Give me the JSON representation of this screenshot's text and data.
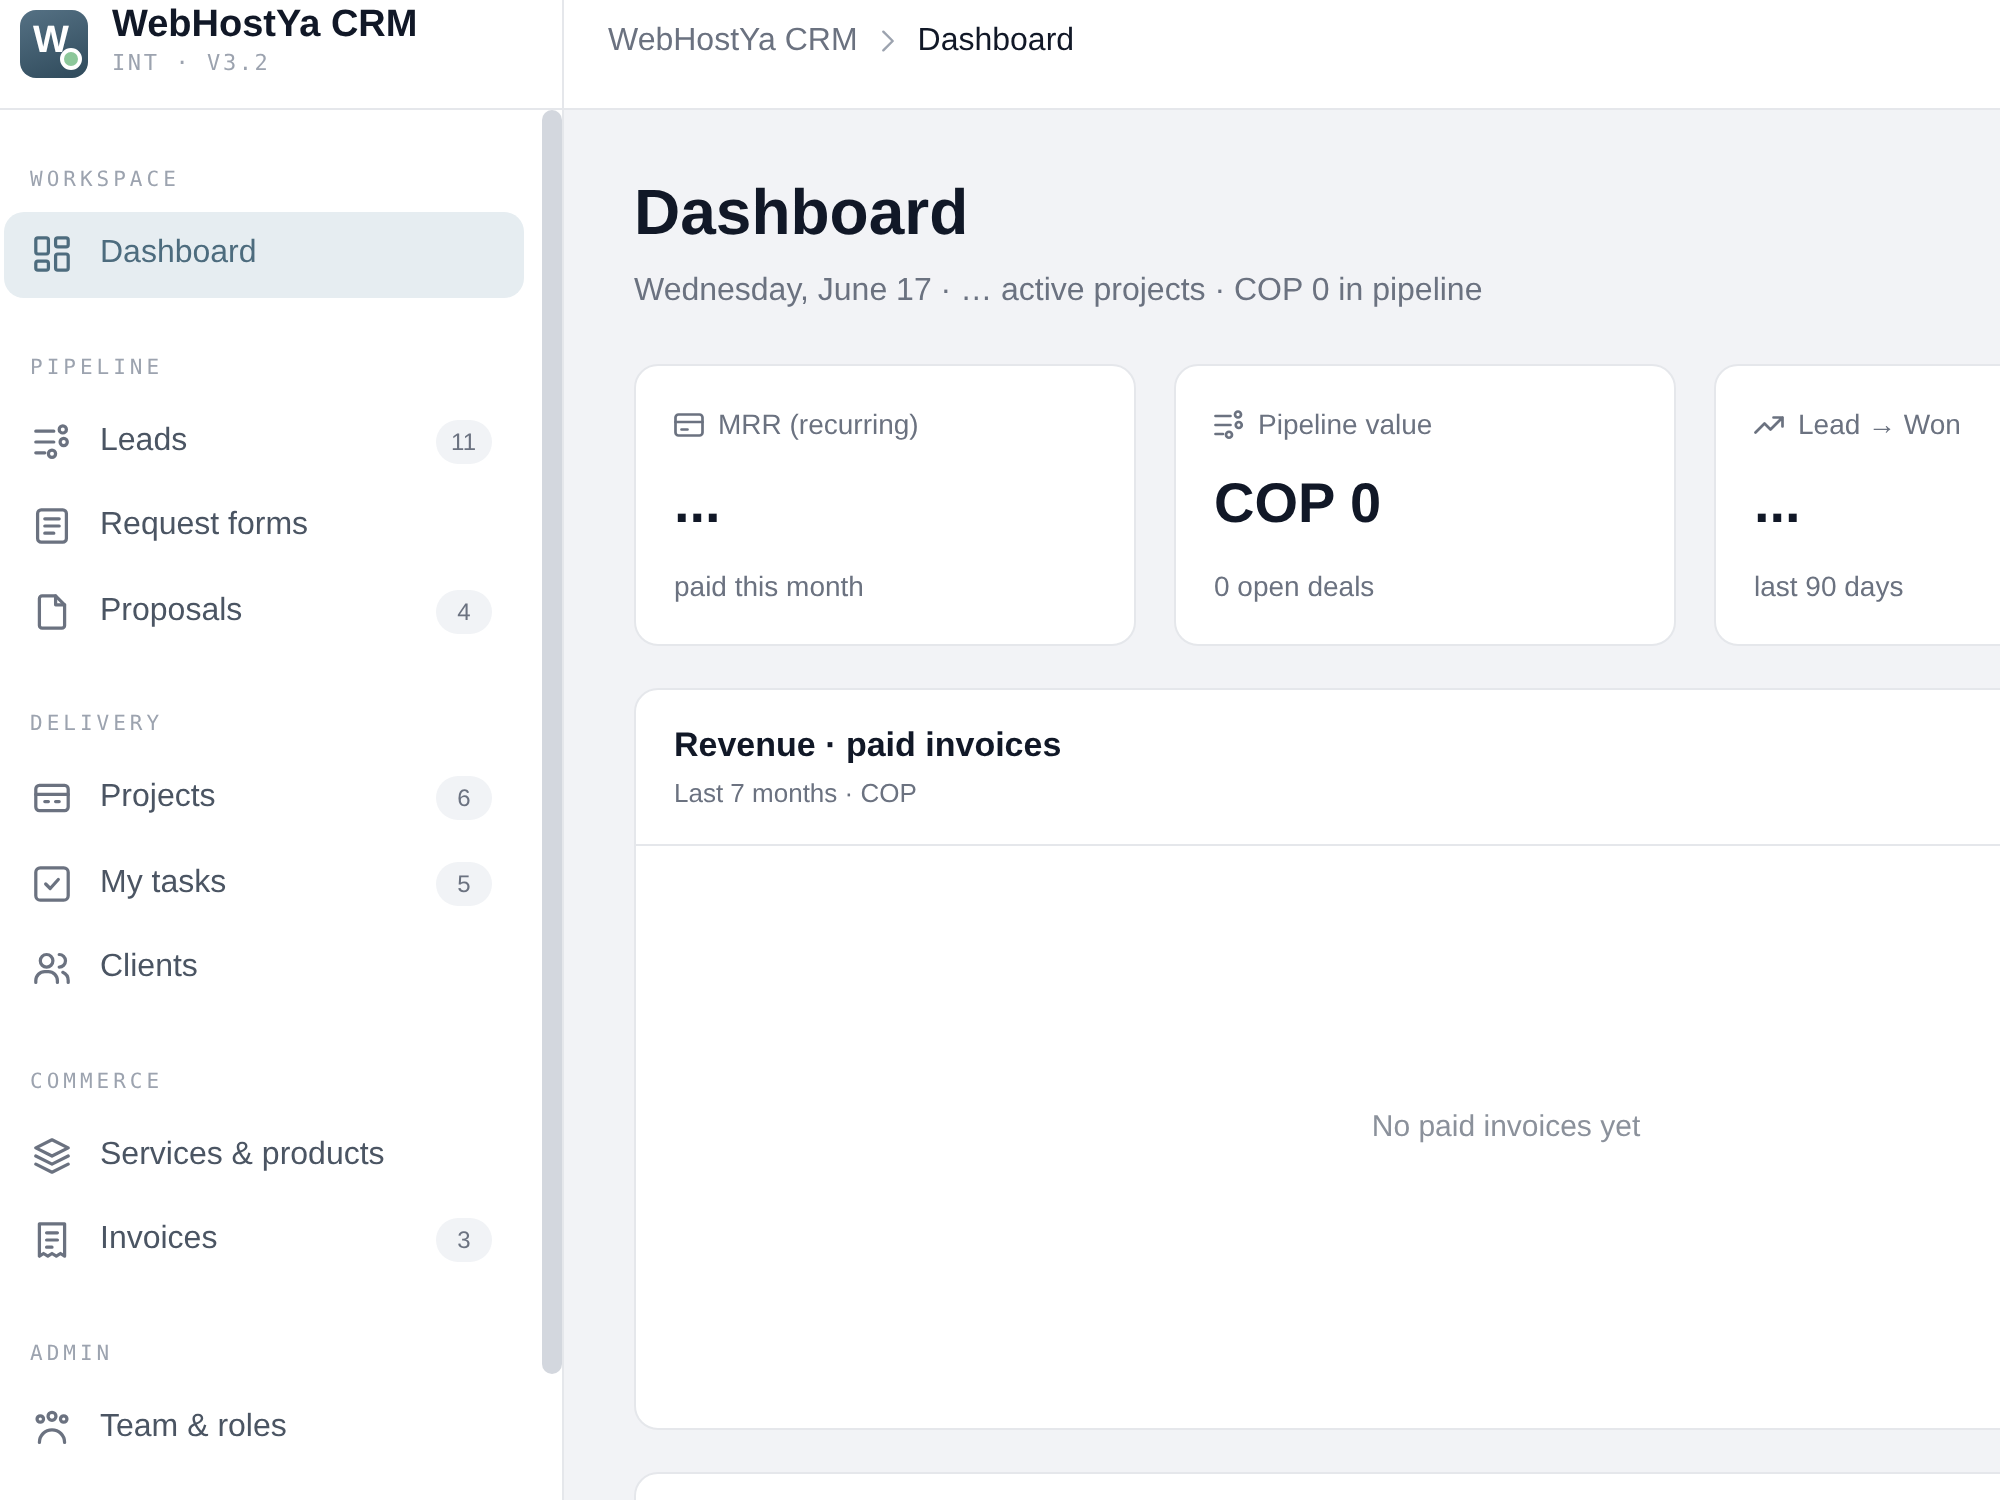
{
  "app": {
    "logo_letter": "W",
    "name": "WebHostYa CRM",
    "version": "INT · V3.2"
  },
  "breadcrumb": [
    {
      "label": "WebHostYa CRM",
      "current": false
    },
    {
      "label": "Dashboard",
      "current": true
    }
  ],
  "sidebar": {
    "sections": [
      {
        "label": "WORKSPACE",
        "items": [
          {
            "label": "Dashboard",
            "selected": true
          }
        ]
      },
      {
        "label": "PIPELINE",
        "items": [
          {
            "label": "Leads",
            "selected": false,
            "badge": "11"
          },
          {
            "label": "Request forms",
            "selected": false
          },
          {
            "label": "Proposals",
            "selected": false,
            "badge": "4"
          }
        ]
      },
      {
        "label": "DELIVERY",
        "items": [
          {
            "label": "Projects",
            "selected": false,
            "badge": "6"
          },
          {
            "label": "My tasks",
            "selected": false,
            "badge": "5"
          },
          {
            "label": "Clients",
            "selected": false
          }
        ]
      },
      {
        "label": "COMMERCE",
        "items": [
          {
            "label": "Services & products",
            "selected": false
          },
          {
            "label": "Invoices",
            "selected": false,
            "badge": "3"
          }
        ]
      },
      {
        "label": "ADMIN",
        "items": [
          {
            "label": "Team & roles",
            "selected": false
          }
        ]
      }
    ]
  },
  "page": {
    "title": "Dashboard",
    "subtitle": "Wednesday, June 17 · … active projects · COP 0 in pipeline"
  },
  "stats": [
    {
      "label": "MRR (recurring)",
      "value": "...",
      "caption": "paid this month"
    },
    {
      "label": "Pipeline value",
      "value": "COP 0",
      "caption": "0 open deals"
    },
    {
      "label": "Lead → Won",
      "value": "...",
      "caption": "last 90 days"
    }
  ],
  "revenue": {
    "title": "Revenue · paid invoices",
    "subtitle": "Last 7 months · COP",
    "empty_text": "No paid invoices yet"
  }
}
